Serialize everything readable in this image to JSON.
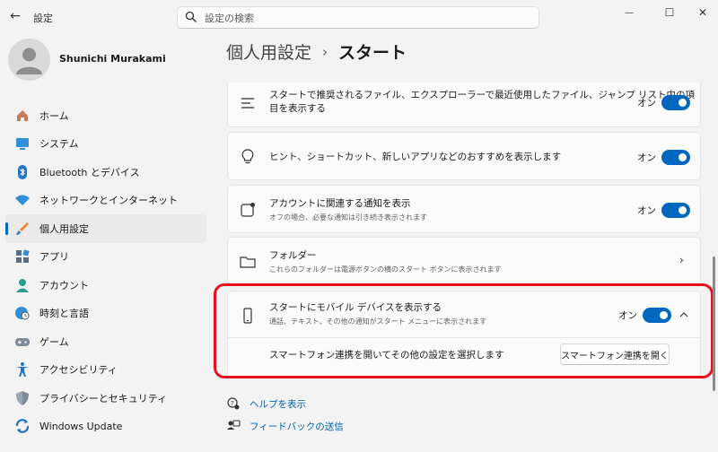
{
  "window": {
    "app_title": "設定",
    "back_glyph": "←",
    "minimize_glyph": "—",
    "maximize_glyph": "☐",
    "close_glyph": "✕"
  },
  "search": {
    "placeholder": "設定の検索"
  },
  "profile": {
    "name": "Shunichi Murakami"
  },
  "sidebar": {
    "items": [
      {
        "label": "ホーム",
        "icon": "home-icon"
      },
      {
        "label": "システム",
        "icon": "system-icon"
      },
      {
        "label": "Bluetooth とデバイス",
        "icon": "bluetooth-icon"
      },
      {
        "label": "ネットワークとインターネット",
        "icon": "wifi-icon"
      },
      {
        "label": "個人用設定",
        "icon": "brush-icon",
        "active": true
      },
      {
        "label": "アプリ",
        "icon": "apps-icon"
      },
      {
        "label": "アカウント",
        "icon": "account-icon"
      },
      {
        "label": "時刻と言語",
        "icon": "globe-clock-icon"
      },
      {
        "label": "ゲーム",
        "icon": "gamepad-icon"
      },
      {
        "label": "アクセシビリティ",
        "icon": "accessibility-icon"
      },
      {
        "label": "プライバシーとセキュリティ",
        "icon": "shield-icon"
      },
      {
        "label": "Windows Update",
        "icon": "windows-update-icon"
      }
    ]
  },
  "breadcrumb": {
    "parent": "個人用設定",
    "separator": "›",
    "current": "スタート"
  },
  "settings": {
    "recommended_files": {
      "title_line1": "スタートで推奨されるファイル、エクスプローラーで最近使用したファイル、ジャンプ リスト内の項",
      "title_line2": "目を表示する",
      "toggle_label": "オン",
      "state": true
    },
    "tips": {
      "title": "ヒント、ショートカット、新しいアプリなどのおすすめを表示します",
      "toggle_label": "オン",
      "state": true
    },
    "account_notifications": {
      "title": "アカウントに関連する通知を表示",
      "subtitle": "オフの場合、必要な通知は引き続き表示されます",
      "toggle_label": "オン",
      "state": true
    },
    "folders": {
      "title": "フォルダー",
      "subtitle": "これらのフォルダーは電源ボタンの横のスタート ボタンに表示されます"
    },
    "mobile_device": {
      "title": "スタートにモバイル デバイスを表示する",
      "subtitle": "通話、テキスト、その他の通知がスタート メニューに表示されます",
      "toggle_label": "オン",
      "state": true,
      "detail_text": "スマートフォン連携を開いてその他の設定を選択します",
      "button_label": "スマートフォン連携を開く"
    }
  },
  "help": {
    "get_help": "ヘルプを表示",
    "feedback": "フィードバックの送信"
  },
  "colors": {
    "accent": "#0067c0",
    "highlight": "#e8101a",
    "link": "#0063b1"
  }
}
